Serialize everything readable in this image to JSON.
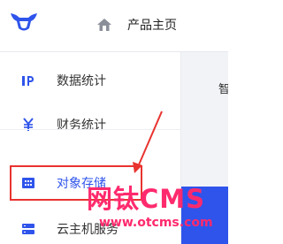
{
  "header": {
    "home_label": "产品主页"
  },
  "sidebar": {
    "items": [
      {
        "label": "数据统计",
        "icon": "bar-chart-icon"
      },
      {
        "label": "财务统计",
        "icon": "yen-icon"
      },
      {
        "label": "对象存储",
        "icon": "storage-grid-icon",
        "active": true
      },
      {
        "label": "云主机服务",
        "icon": "server-icon"
      }
    ]
  },
  "main": {
    "partial_text": "智"
  },
  "annotation": {
    "color": "#e8332f"
  },
  "watermark": {
    "title": "网钛CMS",
    "url": "www.otcms.com"
  },
  "colors": {
    "accent": "#2f54eb",
    "watermark": "#ff2a6d"
  }
}
